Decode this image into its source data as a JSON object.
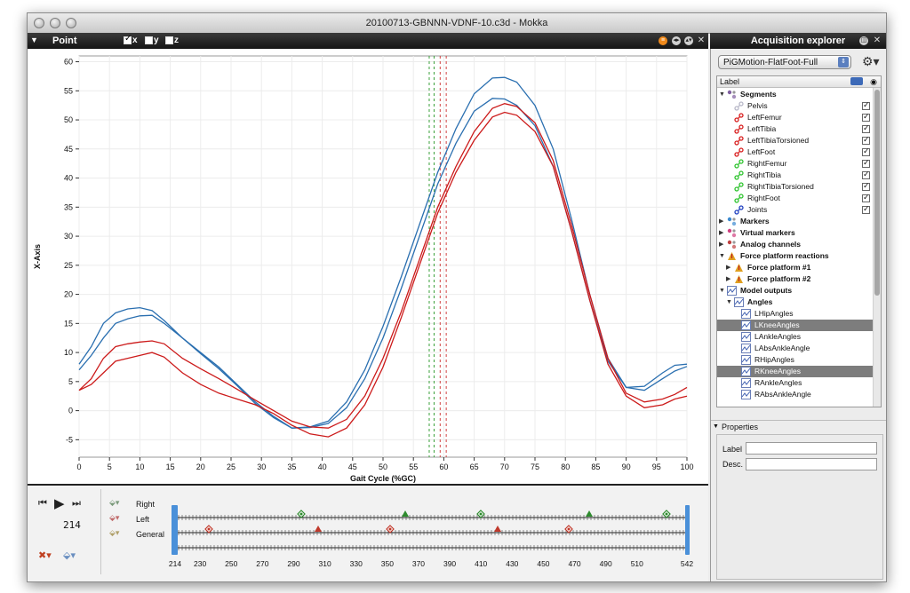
{
  "window": {
    "title": "20100713-GBNNN-VDNF-10.c3d - Mokka"
  },
  "plot_panel": {
    "title": "Point",
    "components": [
      {
        "label": "x",
        "checked": true
      },
      {
        "label": "y",
        "checked": false
      },
      {
        "label": "z",
        "checked": false
      }
    ]
  },
  "chart_data": {
    "type": "line",
    "xlabel": "Gait Cycle (%GC)",
    "ylabel": "X-Axis",
    "xlim": [
      0,
      100
    ],
    "ylim": [
      -8,
      61
    ],
    "xticks": [
      0,
      5,
      10,
      15,
      20,
      25,
      30,
      35,
      40,
      45,
      50,
      55,
      60,
      65,
      70,
      75,
      80,
      85,
      90,
      95,
      100
    ],
    "yticks": [
      -5,
      0,
      5,
      10,
      15,
      20,
      25,
      30,
      35,
      40,
      45,
      50,
      55,
      60
    ],
    "grid": true,
    "series": [
      {
        "color": "#2a6fb0",
        "x": [
          0,
          2,
          4,
          6,
          8,
          10,
          12,
          14,
          17,
          20,
          23,
          26,
          29,
          32,
          35,
          38,
          41,
          44,
          47,
          50,
          53,
          56,
          59,
          62,
          65,
          68,
          70,
          72,
          75,
          78,
          81,
          84,
          87,
          90,
          93,
          96,
          98,
          100
        ],
        "y": [
          8,
          11,
          15,
          16.8,
          17.5,
          17.7,
          17.2,
          15.5,
          12.5,
          10,
          7.5,
          4.5,
          1.5,
          -1,
          -3,
          -2.8,
          -1.8,
          1.5,
          7,
          14.5,
          23,
          32,
          41,
          48.5,
          54.5,
          57.2,
          57.3,
          56.5,
          52.5,
          45,
          33,
          20,
          9,
          4,
          4.2,
          6.5,
          7.8,
          8
        ]
      },
      {
        "color": "#2a6fb0",
        "x": [
          0,
          2,
          4,
          6,
          8,
          10,
          12,
          14,
          17,
          20,
          23,
          26,
          29,
          32,
          35,
          38,
          41,
          44,
          47,
          50,
          53,
          56,
          59,
          62,
          65,
          68,
          70,
          72,
          75,
          78,
          81,
          84,
          87,
          90,
          93,
          96,
          98,
          100
        ],
        "y": [
          7,
          9.5,
          12.5,
          15,
          15.8,
          16.3,
          16.4,
          15,
          12.5,
          9.8,
          7.2,
          4.3,
          1.2,
          -1.2,
          -3,
          -2.9,
          -2.2,
          0.5,
          5.5,
          12.5,
          21,
          30,
          39,
          46,
          51.5,
          53.7,
          53.6,
          52.5,
          49,
          42,
          31,
          19,
          8.5,
          4,
          3.5,
          5.5,
          6.8,
          7.6
        ]
      },
      {
        "color": "#cc1a1a",
        "x": [
          0,
          2,
          4,
          6,
          8,
          10,
          12,
          14,
          17,
          20,
          23,
          26,
          29,
          32,
          35,
          38,
          41,
          44,
          47,
          50,
          53,
          56,
          59,
          62,
          65,
          68,
          70,
          72,
          75,
          78,
          81,
          84,
          87,
          90,
          93,
          96,
          98,
          100
        ],
        "y": [
          3.5,
          5.5,
          9,
          11,
          11.5,
          11.8,
          12,
          11.5,
          9,
          7.2,
          5.5,
          3.7,
          1.8,
          0,
          -1.8,
          -2.8,
          -3,
          -1.5,
          2.5,
          9,
          17,
          26,
          35,
          42,
          48,
          52,
          52.8,
          52.3,
          49.5,
          43,
          32,
          20,
          9,
          3,
          1.5,
          2,
          2.8,
          4
        ]
      },
      {
        "color": "#cc1a1a",
        "x": [
          0,
          2,
          4,
          6,
          8,
          10,
          12,
          14,
          17,
          20,
          23,
          26,
          29,
          32,
          35,
          38,
          41,
          44,
          47,
          50,
          53,
          56,
          59,
          62,
          65,
          68,
          70,
          72,
          75,
          78,
          81,
          84,
          87,
          90,
          93,
          96,
          98,
          100
        ],
        "y": [
          3.5,
          4.5,
          6.5,
          8.5,
          9,
          9.5,
          10,
          9.2,
          6.5,
          4.5,
          3,
          2,
          1,
          -0.5,
          -2.5,
          -4,
          -4.5,
          -3,
          1,
          7.5,
          16,
          25,
          34,
          41,
          46.5,
          50.5,
          51.3,
          50.8,
          48,
          42,
          31,
          19,
          8,
          2.5,
          0.5,
          1,
          2,
          2.5
        ]
      }
    ],
    "event_lines": [
      {
        "x": 57.6,
        "color": "#3aa03a"
      },
      {
        "x": 58.4,
        "color": "#3aa03a"
      },
      {
        "x": 59.4,
        "color": "#d04040"
      },
      {
        "x": 60.4,
        "color": "#d04040"
      }
    ]
  },
  "timeline": {
    "current_frame": "214",
    "rows": [
      {
        "label": "Right"
      },
      {
        "label": "Left"
      },
      {
        "label": "General"
      }
    ],
    "frame_ticks": [
      "214",
      "230",
      "250",
      "270",
      "290",
      "310",
      "330",
      "350",
      "370",
      "390",
      "410",
      "430",
      "450",
      "470",
      "490",
      "510",
      "542"
    ]
  },
  "explorer": {
    "title": "Acquisition explorer",
    "model_combo": "PiGMotion-FlatFoot-Full",
    "tree_header": "Label",
    "items": [
      {
        "label": "Segments",
        "level": 0,
        "expanded": true,
        "bold": true,
        "icon": "segments-icon"
      },
      {
        "label": "Pelvis",
        "level": 1,
        "checked": true,
        "icon": "segment-gray-icon"
      },
      {
        "label": "LeftFemur",
        "level": 1,
        "checked": true,
        "icon": "segment-red-icon"
      },
      {
        "label": "LeftTibia",
        "level": 1,
        "checked": true,
        "icon": "segment-red-icon"
      },
      {
        "label": "LeftTibiaTorsioned",
        "level": 1,
        "checked": true,
        "icon": "segment-red-icon"
      },
      {
        "label": "LeftFoot",
        "level": 1,
        "checked": true,
        "icon": "segment-red-icon"
      },
      {
        "label": "RightFemur",
        "level": 1,
        "checked": true,
        "icon": "segment-green-icon"
      },
      {
        "label": "RightTibia",
        "level": 1,
        "checked": true,
        "icon": "segment-green-icon"
      },
      {
        "label": "RightTibiaTorsioned",
        "level": 1,
        "checked": true,
        "icon": "segment-green-icon"
      },
      {
        "label": "RightFoot",
        "level": 1,
        "checked": true,
        "icon": "segment-green-icon"
      },
      {
        "label": "Joints",
        "level": 1,
        "checked": true,
        "icon": "segment-blue-icon"
      },
      {
        "label": "Markers",
        "level": 0,
        "expanded": false,
        "bold": true,
        "icon": "markers-icon"
      },
      {
        "label": "Virtual markers",
        "level": 0,
        "expanded": false,
        "bold": true,
        "icon": "virtual-markers-icon"
      },
      {
        "label": "Analog channels",
        "level": 0,
        "expanded": false,
        "bold": true,
        "icon": "analog-icon"
      },
      {
        "label": "Force platform reactions",
        "level": 0,
        "expanded": true,
        "bold": true,
        "icon": "force-icon"
      },
      {
        "label": "Force platform #1",
        "level": 1,
        "expanded": false,
        "bold": true,
        "icon": "force-icon"
      },
      {
        "label": "Force platform #2",
        "level": 1,
        "expanded": false,
        "bold": true,
        "icon": "force-icon"
      },
      {
        "label": "Model outputs",
        "level": 0,
        "expanded": true,
        "bold": true,
        "icon": "model-icon"
      },
      {
        "label": "Angles",
        "level": 1,
        "expanded": true,
        "bold": true,
        "icon": "model-icon"
      },
      {
        "label": "LHipAngles",
        "level": 2,
        "icon": "angle-icon"
      },
      {
        "label": "LKneeAngles",
        "level": 2,
        "selected": true,
        "icon": "angle-icon"
      },
      {
        "label": "LAnkleAngles",
        "level": 2,
        "icon": "angle-icon"
      },
      {
        "label": "LAbsAnkleAngle",
        "level": 2,
        "icon": "angle-icon"
      },
      {
        "label": "RHipAngles",
        "level": 2,
        "icon": "angle-icon"
      },
      {
        "label": "RKneeAngles",
        "level": 2,
        "selected": true,
        "icon": "angle-icon"
      },
      {
        "label": "RAnkleAngles",
        "level": 2,
        "icon": "angle-icon"
      },
      {
        "label": "RAbsAnkleAngle",
        "level": 2,
        "icon": "angle-icon"
      }
    ],
    "properties": {
      "header": "Properties",
      "label_field": "Label",
      "desc_field": "Desc.",
      "label_value": "",
      "desc_value": ""
    }
  }
}
